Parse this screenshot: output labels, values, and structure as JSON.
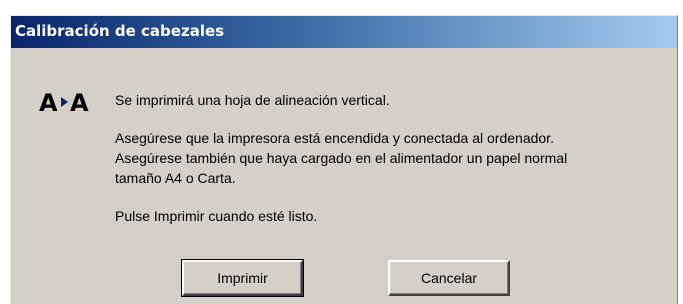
{
  "window": {
    "title": "Calibración de cabezales",
    "title_gradient": [
      "#0a246a",
      "#a6caf0"
    ],
    "background": "#d4d0c8"
  },
  "icon": {
    "name": "align-aa-icon",
    "letters": "A A",
    "arrow_color": "#0a246a"
  },
  "messages": {
    "line1": "Se imprimirá una hoja de alineación vertical.",
    "line2": "Asegúrese que la impresora está encendida y conectada al ordenador.",
    "line3": "Asegúrese también que haya cargado en el alimentador un papel normal",
    "line4": "tamaño A4 o Carta.",
    "line5": "Pulse Imprimir cuando esté listo."
  },
  "buttons": {
    "print_label": "Imprimir",
    "cancel_label": "Cancelar"
  }
}
